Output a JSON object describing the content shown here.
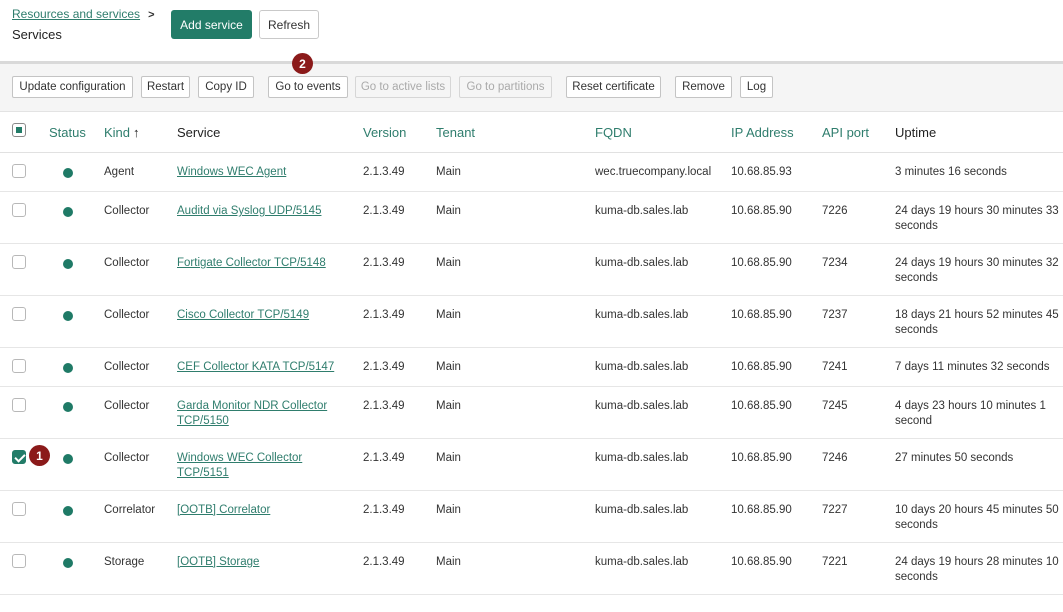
{
  "header": {
    "breadcrumb": "Resources and services",
    "title": "Services",
    "add_service": "Add service",
    "refresh": "Refresh"
  },
  "toolbar": {
    "update_configuration": "Update configuration",
    "restart": "Restart",
    "copy_id": "Copy ID",
    "go_to_events": "Go to events",
    "go_to_active_lists": "Go to active lists",
    "go_to_partitions": "Go to partitions",
    "reset_certificate": "Reset certificate",
    "remove": "Remove",
    "log": "Log"
  },
  "markers": {
    "one": "1",
    "two": "2"
  },
  "columns": {
    "status": "Status",
    "kind": "Kind",
    "service": "Service",
    "version": "Version",
    "tenant": "Tenant",
    "fqdn": "FQDN",
    "ip": "IP Address",
    "api_port": "API port",
    "uptime": "Uptime"
  },
  "rows": [
    {
      "kind": "Agent",
      "service": "Windows WEC Agent",
      "version": "2.1.3.49",
      "tenant": "Main",
      "fqdn": "wec.truecompany.local",
      "ip": "10.68.85.93",
      "port": "",
      "uptime": "3 minutes 16 seconds",
      "checked": false
    },
    {
      "kind": "Collector",
      "service": "Auditd via Syslog UDP/5145",
      "version": "2.1.3.49",
      "tenant": "Main",
      "fqdn": "kuma-db.sales.lab",
      "ip": "10.68.85.90",
      "port": "7226",
      "uptime": "24 days 19 hours 30 minutes 33 seconds",
      "checked": false
    },
    {
      "kind": "Collector",
      "service": "Fortigate Collector TCP/5148",
      "version": "2.1.3.49",
      "tenant": "Main",
      "fqdn": "kuma-db.sales.lab",
      "ip": "10.68.85.90",
      "port": "7234",
      "uptime": "24 days 19 hours 30 minutes 32 seconds",
      "checked": false
    },
    {
      "kind": "Collector",
      "service": "Cisco Collector TCP/5149",
      "version": "2.1.3.49",
      "tenant": "Main",
      "fqdn": "kuma-db.sales.lab",
      "ip": "10.68.85.90",
      "port": "7237",
      "uptime": "18 days 21 hours 52 minutes 45 seconds",
      "checked": false
    },
    {
      "kind": "Collector",
      "service": "CEF Collector KATA TCP/5147",
      "version": "2.1.3.49",
      "tenant": "Main",
      "fqdn": "kuma-db.sales.lab",
      "ip": "10.68.85.90",
      "port": "7241",
      "uptime": "7 days 11 minutes 32 seconds",
      "checked": false
    },
    {
      "kind": "Collector",
      "service": "Garda Monitor NDR Collector TCP/5150",
      "version": "2.1.3.49",
      "tenant": "Main",
      "fqdn": "kuma-db.sales.lab",
      "ip": "10.68.85.90",
      "port": "7245",
      "uptime": "4 days 23 hours 10 minutes 1 second",
      "checked": false
    },
    {
      "kind": "Collector",
      "service": "Windows WEC Collector TCP/5151",
      "version": "2.1.3.49",
      "tenant": "Main",
      "fqdn": "kuma-db.sales.lab",
      "ip": "10.68.85.90",
      "port": "7246",
      "uptime": "27 minutes 50 seconds",
      "checked": true
    },
    {
      "kind": "Correlator",
      "service": "[OOTB] Correlator",
      "version": "2.1.3.49",
      "tenant": "Main",
      "fqdn": "kuma-db.sales.lab",
      "ip": "10.68.85.90",
      "port": "7227",
      "uptime": "10 days 20 hours 45 minutes 50 seconds",
      "checked": false
    },
    {
      "kind": "Storage",
      "service": "[OOTB] Storage",
      "version": "2.1.3.49",
      "tenant": "Main",
      "fqdn": "kuma-db.sales.lab",
      "ip": "10.68.85.90",
      "port": "7221",
      "uptime": "24 days 19 hours 28 minutes 10 seconds",
      "checked": false
    }
  ],
  "colors": {
    "accent": "#227c68",
    "status_ok": "#1f7a66",
    "marker": "#8b1a1a"
  }
}
